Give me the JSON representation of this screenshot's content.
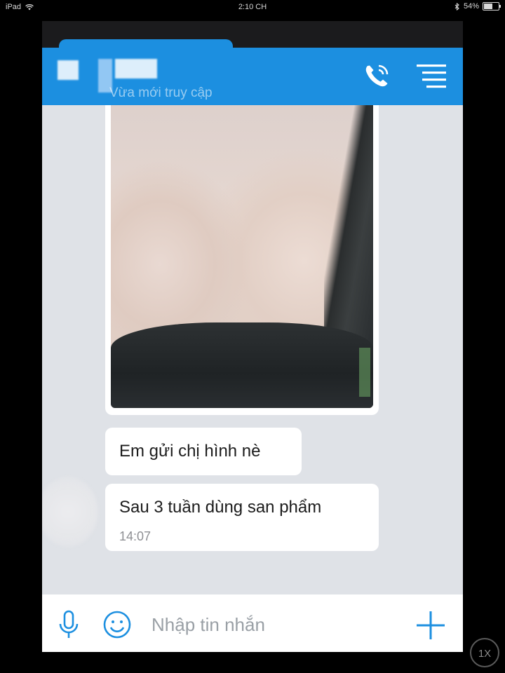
{
  "status_bar": {
    "device": "iPad",
    "time": "2:10 CH",
    "battery_text": "54%",
    "battery_level": 0.54
  },
  "header": {
    "subtitle": "Vừa mới truy cập",
    "call_icon": "phone-icon",
    "menu_icon": "menu-icon",
    "color": "#1c8fe0"
  },
  "messages": [
    {
      "type": "image"
    },
    {
      "type": "text",
      "text": "Em gửi chị hình nè"
    },
    {
      "type": "text",
      "text": "Sau 3 tuần dùng san phẩm",
      "time": "14:07"
    }
  ],
  "input_bar": {
    "placeholder": "Nhập tin nhắn",
    "mic_icon": "microphone-icon",
    "emoji_icon": "smiley-icon",
    "plus_icon": "plus-icon"
  },
  "speed_badge": "1X"
}
